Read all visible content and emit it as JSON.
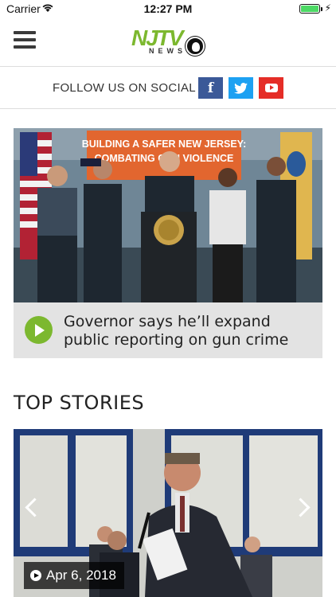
{
  "status_bar": {
    "carrier": "Carrier",
    "time": "12:27 PM",
    "battery_level": 1.0
  },
  "header": {
    "logo_main": "NJTV",
    "logo_sub": "NEWS",
    "menu_icon": "hamburger-icon",
    "brand_color": "#7cb82f"
  },
  "social": {
    "label": "FOLLOW US ON SOCIAL",
    "facebook_glyph": "f",
    "links": [
      {
        "icon": "facebook-icon",
        "color": "#3b5998"
      },
      {
        "icon": "twitter-icon",
        "color": "#1da1f2"
      },
      {
        "icon": "youtube-icon",
        "color": "#e52d27"
      }
    ]
  },
  "featured": {
    "banner_text": "BUILDING A SAFER NEW JERSEY: COMBATING GUN VIOLENCE",
    "headline": "Governor says he’ll expand public reporting on gun crime",
    "play_icon": "play-circle-icon"
  },
  "top_stories": {
    "title": "TOP STORIES",
    "items": [
      {
        "date": "Apr 6, 2018",
        "icon": "play-icon"
      }
    ]
  }
}
